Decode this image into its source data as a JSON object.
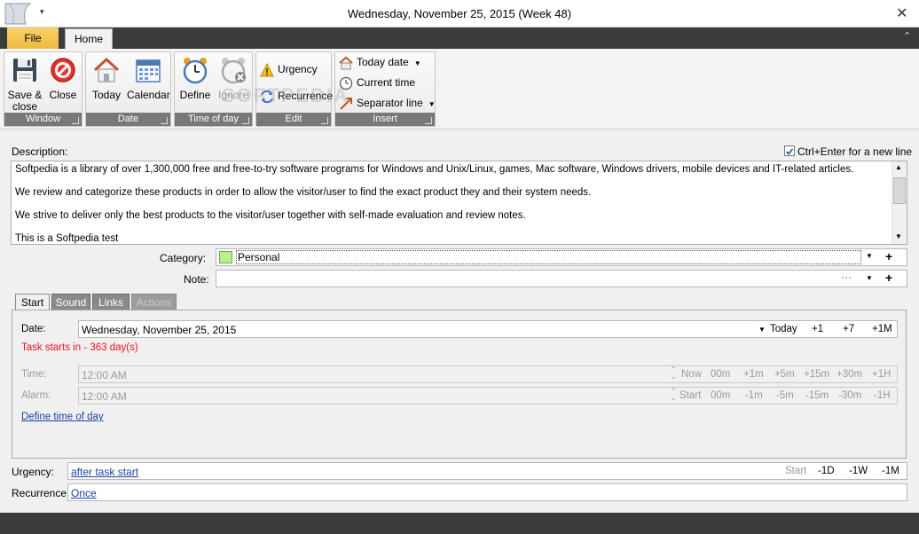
{
  "window": {
    "title": "Wednesday, November 25, 2015 (Week 48)",
    "close_glyph": "✕",
    "qat_glyph": "▾"
  },
  "ribbon": {
    "tabs": [
      {
        "label": "File"
      },
      {
        "label": "Home"
      }
    ],
    "collapse_glyph": "⌃",
    "groups": {
      "window": {
        "label": "Window",
        "save_close": "Save &\nclose",
        "close": "Close"
      },
      "date": {
        "label": "Date",
        "today": "Today",
        "calendar": "Calendar"
      },
      "time_of_day": {
        "label": "Time of day",
        "define": "Define",
        "ignore": "Ignore"
      },
      "edit": {
        "label": "Edit",
        "urgency": "Urgency",
        "recurrence": "Recurrence"
      },
      "insert": {
        "label": "Insert",
        "today_date": "Today date",
        "current_time": "Current time",
        "separator_line": "Separator line"
      }
    },
    "watermark": "SOFTPEDIA"
  },
  "description": {
    "label": "Description:",
    "ctrl_enter_label": "Ctrl+Enter for a new line",
    "ctrl_enter_checked": true,
    "lines": [
      "Softpedia is a library of over 1,300,000 free and free-to-try software programs for Windows and Unix/Linux, games, Mac software, Windows drivers, mobile devices and IT-related articles.",
      "We review and categorize these products in order to allow the visitor/user to find the exact product they and their system needs.",
      "We strive to deliver only the best products to the visitor/user together with self-made evaluation and review notes.",
      "This is a Softpedia test"
    ]
  },
  "category": {
    "label": "Category:",
    "value": "Personal",
    "color": "#b8f08a"
  },
  "note": {
    "label": "Note:",
    "value": "",
    "ellipsis": "···"
  },
  "tabs": [
    {
      "label": "Start",
      "active": true
    },
    {
      "label": "Sound",
      "active": false
    },
    {
      "label": "Links",
      "active": false
    },
    {
      "label": "Actions",
      "active": false,
      "disabled": true
    }
  ],
  "start": {
    "date_label": "Date:",
    "date_value": "Wednesday, November 25, 2015",
    "date_shortcuts": [
      "Today",
      "+1",
      "+7",
      "+1M"
    ],
    "task_starts": "Task starts in - 363 day(s)",
    "time_label": "Time:",
    "time_value": "12:00 AM",
    "time_shortcuts": [
      "Now",
      "00m",
      "+1m",
      "+5m",
      "+15m",
      "+30m",
      "+1H"
    ],
    "alarm_label": "Alarm:",
    "alarm_value": "12:00 AM",
    "alarm_shortcuts": [
      "Start",
      "00m",
      "-1m",
      "-5m",
      "-15m",
      "-30m",
      "-1H"
    ],
    "define_link": "Define time of day"
  },
  "urgency": {
    "label": "Urgency:",
    "value": "after task start",
    "shortcuts": [
      "Start",
      "-1D",
      "-1W",
      "-1M"
    ]
  },
  "recurrence": {
    "label": "Recurrence:",
    "value": "Once"
  },
  "colors": {
    "accent_file_tab": "#f0b840",
    "dark_bar": "#3c3c3c",
    "warning_text": "#e81123",
    "link": "#1a3fa8"
  }
}
